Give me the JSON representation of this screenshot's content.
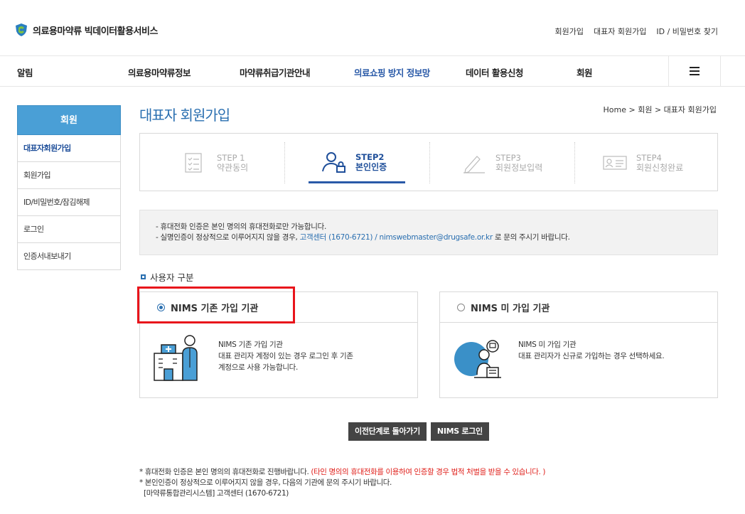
{
  "header": {
    "logo_text": "의료용마약류 빅데이터활용서비스",
    "links": [
      "회원가입",
      "대표자 회원가입",
      "ID / 비밀번호 찾기"
    ]
  },
  "gnb": {
    "items": [
      "알림",
      "의료용마약류정보",
      "마약류취급기관안내",
      "의료쇼핑 방지 정보망",
      "데이터 활용신청",
      "회원"
    ],
    "active_index": 3
  },
  "lnb": {
    "title": "회원",
    "items": [
      "대표자회원가입",
      "회원가입",
      "ID/비밀번호/잠김해제",
      "로그인",
      "인증서내보내기"
    ],
    "active_index": 0
  },
  "page": {
    "title": "대표자 회원가입",
    "breadcrumb": "Home > 회원 > 대표자 회원가입"
  },
  "steps": [
    {
      "num": "STEP 1",
      "label": "약관동의",
      "icon": "document-list-icon"
    },
    {
      "num": "STEP2",
      "label": "본인인증",
      "icon": "user-auth-icon"
    },
    {
      "num": "STEP3",
      "label": "회원정보입력",
      "icon": "pencil-icon"
    },
    {
      "num": "STEP4",
      "label": "회원신청완료",
      "icon": "id-card-icon"
    }
  ],
  "active_step": 1,
  "notice": {
    "line1": "- 휴대전화 인증은 본인 명의의 휴대전화로만 가능합니다.",
    "line2_pre": "- 실명인증이 정상적으로 이루어지지 않을 경우, ",
    "line2_link": "고객센터 (1670-6721) / nimswebmaster@drugsafe.or.kr",
    "line2_post": " 로 문의 주시기 바랍니다."
  },
  "section_label": "사용자 구분",
  "options": [
    {
      "title": "NIMS 기존 가입 기관",
      "selected": true,
      "desc": [
        "NIMS 기존 가입 기관",
        "대표 관리자 계정이 있는 경우 로그인 후 기존",
        "계정으로 사용 가능합니다."
      ]
    },
    {
      "title": "NIMS 미 가입 기관",
      "selected": false,
      "desc": [
        "NIMS 미 가입 기관",
        "대표 관리자가 신규로 가입하는 경우 선택하세요."
      ]
    }
  ],
  "buttons": {
    "prev": "이전단계로 돌아가기",
    "login": "NIMS 로그인"
  },
  "footnotes": {
    "line1_pre": "* 휴대전화 인증은 본인 명의의 휴대전화로 진행바랍니다. ",
    "line1_red": "(타인 명의의 휴대전화를 이용하여 인증할 경우 법적 처벌을 받을 수 있습니다. )",
    "line2": "* 본인인증이 정상적으로 이루어지지 않을 경우, 다음의 기관에 문의 주시기 바랍니다.",
    "line3": "[마약류통합관리시스템] 고객센터 (1670-6721)"
  },
  "colors": {
    "accent": "#2a6fb0",
    "lnb_title_bg": "#4a9fd6",
    "highlight": "#e8141b",
    "button_bg": "#444444",
    "warning": "#e0201b"
  }
}
